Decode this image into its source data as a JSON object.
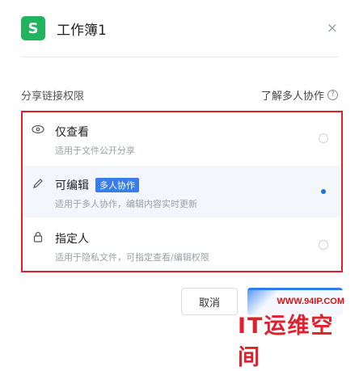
{
  "header": {
    "app_icon_letter": "S",
    "title": "工作簿1",
    "close_glyph": "×"
  },
  "section": {
    "label": "分享链接权限",
    "learn_more": "了解多人协作",
    "help_glyph": "?"
  },
  "options": [
    {
      "icon": "eye-icon",
      "title": "仅查看",
      "desc": "适用于文件公开分享",
      "badge": "",
      "selected": false
    },
    {
      "icon": "pencil-icon",
      "title": "可编辑",
      "desc": "适用于多人协作，编辑内容实时更新",
      "badge": "多人协作",
      "selected": true
    },
    {
      "icon": "lock-icon",
      "title": "指定人",
      "desc": "适用于隐私文件，可指定查看/编辑权限",
      "badge": "",
      "selected": false
    }
  ],
  "footer": {
    "cancel_label": "取消"
  },
  "watermark": {
    "url": "WWW.94IP.COM",
    "name": "IT运维空间"
  },
  "colors": {
    "accent": "#2f7cf0",
    "app_icon": "#22b35e",
    "highlight_border": "#e0202c"
  }
}
